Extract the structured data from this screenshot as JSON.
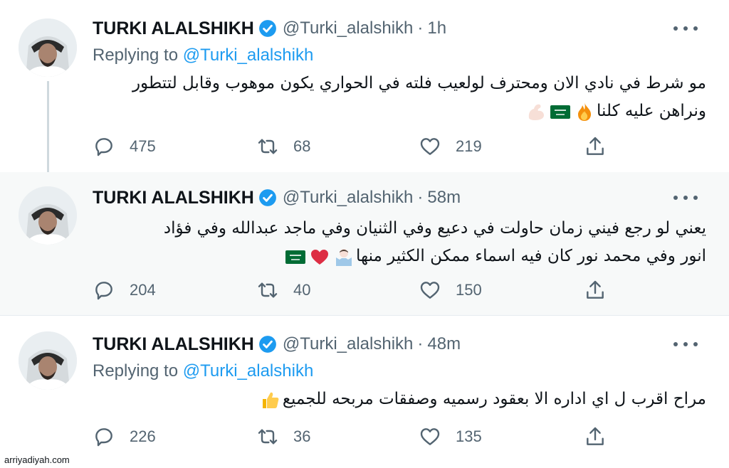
{
  "tweets": [
    {
      "name": "TURKI ALALSHIKH",
      "handle": "@Turki_alalshikh",
      "separator": "·",
      "time": "1h",
      "replying_prefix": "Replying to",
      "replying_to": "@Turki_alalshikh",
      "text_line1": "مو شرط في نادي الان ومحترف لولعيب فلته في الحواري يكون موهوب وقابل لتتطور",
      "text_line2": "ونراهن عليه كلنا",
      "emojis": [
        "fire-emoji",
        "saudi-flag-emoji",
        "flexed-biceps-emoji"
      ],
      "replies": "475",
      "retweets": "68",
      "likes": "219"
    },
    {
      "name": "TURKI ALALSHIKH",
      "handle": "@Turki_alalshikh",
      "separator": "·",
      "time": "58m",
      "text_line1": "يعني لو رجع فيني زمان حاولت في دعيع وفي الثنيان وفي ماجد عبدالله وفي فؤاد",
      "text_line2": "انور وفي محمد نور كان فيه اسماء ممكن الكثير منها",
      "emojis": [
        "person-shrugging-emoji",
        "red-heart-emoji",
        "saudi-flag-emoji"
      ],
      "replies": "204",
      "retweets": "40",
      "likes": "150"
    },
    {
      "name": "TURKI ALALSHIKH",
      "handle": "@Turki_alalshikh",
      "separator": "·",
      "time": "48m",
      "replying_prefix": "Replying to",
      "replying_to": "@Turki_alalshikh",
      "text_line1": "مراح اقرب ل اي اداره الا بعقود رسميه وصفقات مربحه للجميع",
      "emojis": [
        "thumbs-up-emoji"
      ],
      "replies": "226",
      "retweets": "36",
      "likes": "135"
    }
  ],
  "icons": {
    "verified": "verified-badge-icon",
    "reply": "reply-icon",
    "retweet": "retweet-icon",
    "like": "heart-icon",
    "share": "share-icon",
    "more": "more-icon"
  },
  "colors": {
    "accent": "#1d9bf0",
    "muted_text": "#536471",
    "primary_text": "#0f1419",
    "separator": "#e6ecf0"
  },
  "watermark": "arriyadiyah.com"
}
